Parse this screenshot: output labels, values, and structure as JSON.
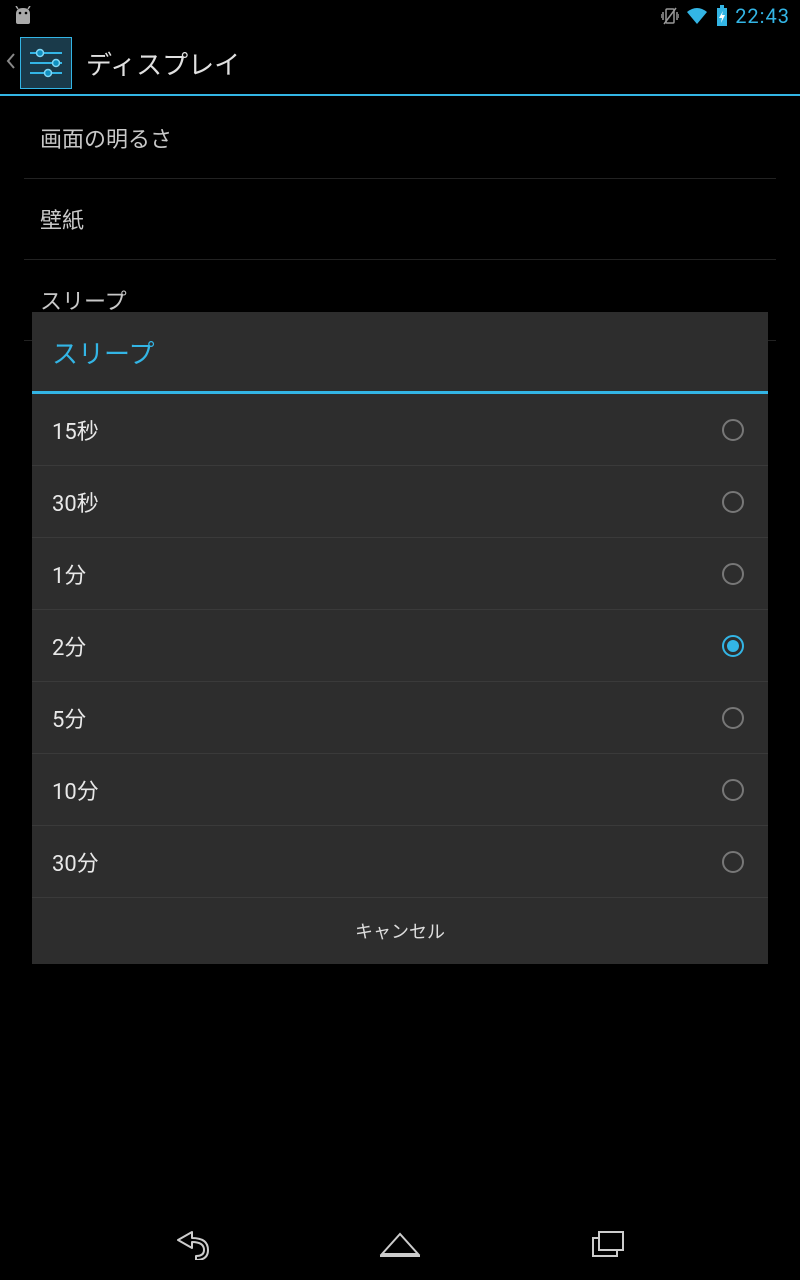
{
  "status": {
    "clock": "22:43"
  },
  "actionbar": {
    "title": "ディスプレイ"
  },
  "settings": {
    "items": [
      {
        "label": "画面の明るさ"
      },
      {
        "label": "壁紙"
      },
      {
        "label": "スリープ"
      }
    ]
  },
  "dialog": {
    "title": "スリープ",
    "cancel": "キャンセル",
    "options": [
      {
        "label": "15秒",
        "selected": false
      },
      {
        "label": "30秒",
        "selected": false
      },
      {
        "label": "1分",
        "selected": false
      },
      {
        "label": "2分",
        "selected": true
      },
      {
        "label": "5分",
        "selected": false
      },
      {
        "label": "10分",
        "selected": false
      },
      {
        "label": "30分",
        "selected": false
      }
    ]
  },
  "colors": {
    "accent": "#33b5e5",
    "dialog_bg": "#2d2d2d"
  }
}
